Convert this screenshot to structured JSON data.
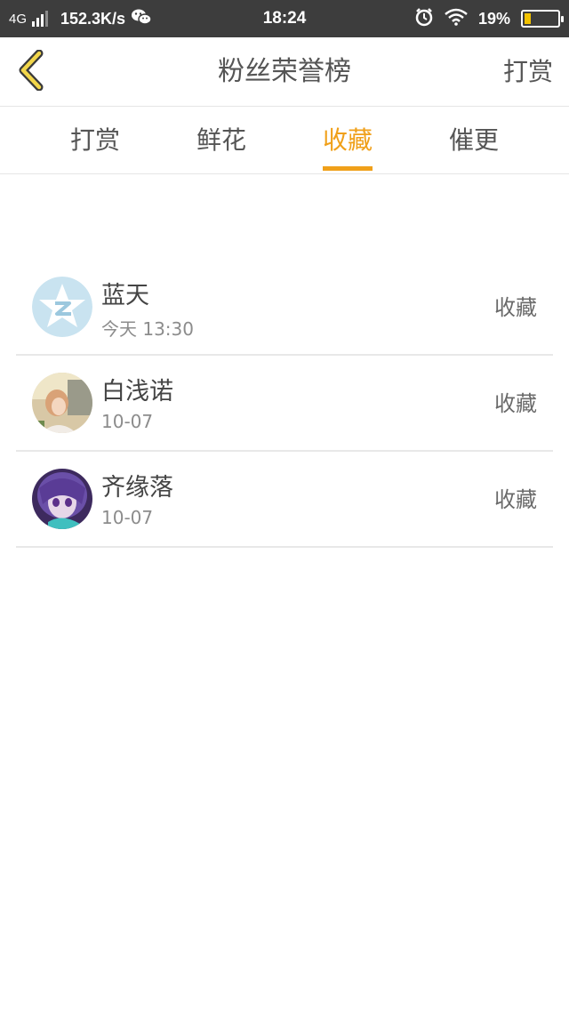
{
  "status_bar": {
    "network": "4G",
    "speed": "152.3K/s",
    "time": "18:24",
    "battery": "19%",
    "battery_level": 0.19,
    "battery_color": "#f2c200"
  },
  "nav": {
    "back_icon": "chevron-left-icon",
    "title": "粉丝荣誉榜",
    "action_label": "打赏"
  },
  "tabs": [
    {
      "label": "打赏",
      "active": false
    },
    {
      "label": "鲜花",
      "active": false
    },
    {
      "label": "收藏",
      "active": true
    },
    {
      "label": "催更",
      "active": false
    }
  ],
  "accent_color": "#f0a01a",
  "fans": [
    {
      "name": "蓝天",
      "time": "今天 13:30",
      "action": "收藏",
      "avatar": "qq-zone-avatar"
    },
    {
      "name": "白浅诺",
      "time": "10-07",
      "action": "收藏",
      "avatar": "photo-avatar"
    },
    {
      "name": "齐缘落",
      "time": "10-07",
      "action": "收藏",
      "avatar": "anime-avatar"
    }
  ]
}
